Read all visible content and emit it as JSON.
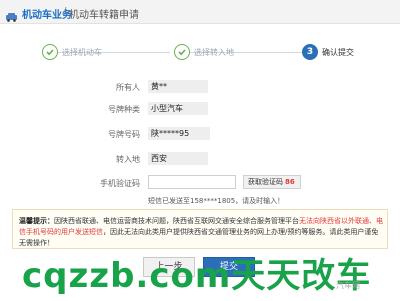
{
  "breadcrumb": {
    "section": "机动车业务",
    "separator": "/",
    "page": "机动车转籍申请"
  },
  "steps": [
    {
      "label": "选择机动车",
      "state": "done"
    },
    {
      "label": "选择转入地",
      "state": "done"
    },
    {
      "number": "3",
      "label": "确认提交",
      "state": "active"
    }
  ],
  "form": {
    "owner_label": "所有人",
    "owner_value": "黄**",
    "plate_type_label": "号牌种类",
    "plate_type_value": "小型汽车",
    "plate_no_label": "号牌号码",
    "plate_no_value": "陕*****95",
    "destination_label": "转入地",
    "destination_value": "西安",
    "phone_code_label": "手机验证码",
    "phone_code_value": "",
    "get_code_label": "获取验证码",
    "get_code_countdown": "86",
    "sms_hint": "短信已发送至158****1805，请及时输入！"
  },
  "notice": {
    "title": "温馨提示：",
    "text_plain_1": "因陕西省联通、电信运营商技术问题，陕西省互联网交通安全综合服务管理平台",
    "text_red": "无法向陕西省以外联通、电信手机号码的用户发送短信",
    "text_plain_2": "，因此无法向此类用户提供陕西省交通管理业务的网上办理/预约等服务。请此类用户谨免无需操作！"
  },
  "buttons": {
    "prev": "上一步",
    "submit": "提交"
  },
  "watermark": {
    "big": "cqzzb.com天天改车",
    "small": "汽车网"
  },
  "colors": {
    "accent_blue": "#2a6fb8",
    "step_done_green": "#6ab04c",
    "warning_red": "#e13a3a",
    "watermark_green": "#18a34a"
  }
}
